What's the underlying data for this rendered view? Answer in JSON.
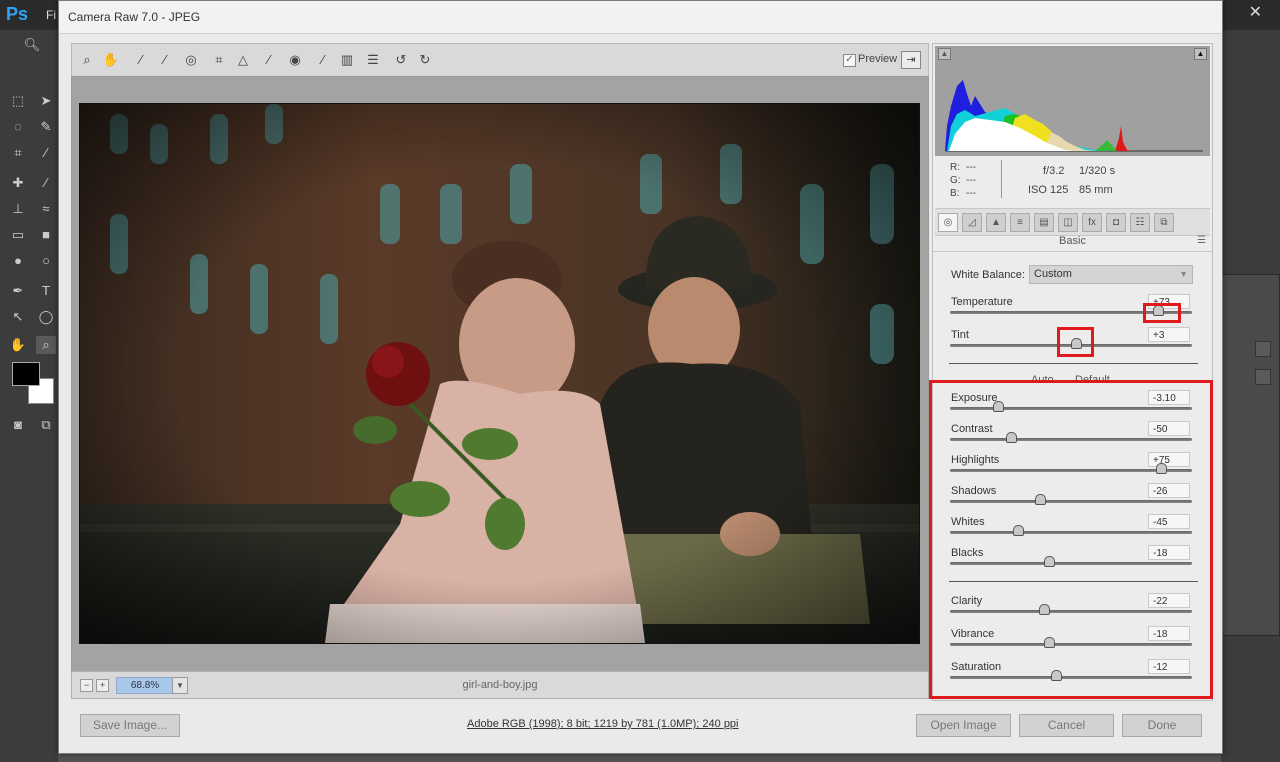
{
  "ps": {
    "logo": "Ps",
    "menu": "Fi",
    "close": "✕"
  },
  "dialog": {
    "title": "Camera Raw 7.0  -  JPEG",
    "preview_label": "Preview",
    "preview_checked": true,
    "zoom": "68.8%",
    "filename": "girl-and-boy.jpg",
    "save_button": "Save Image...",
    "info_link": "Adobe RGB (1998); 8 bit; 1219 by 781 (1.0MP); 240 ppi",
    "open_button": "Open Image",
    "cancel_button": "Cancel",
    "done_button": "Done"
  },
  "info": {
    "r_label": "R:",
    "r_value": "---",
    "g_label": "G:",
    "g_value": "---",
    "b_label": "B:",
    "b_value": "---",
    "aperture": "f/3.2",
    "shutter": "1/320 s",
    "iso": "ISO 125",
    "focal": "85 mm"
  },
  "panel": {
    "title": "Basic",
    "wb_label": "White Balance:",
    "wb_value": "Custom",
    "auto": "Auto",
    "default": "Default"
  },
  "sliders_wb": [
    {
      "label": "Temperature",
      "value": "+73",
      "pos": 0.86
    },
    {
      "label": "Tint",
      "value": "+3",
      "pos": 0.52
    }
  ],
  "sliders_tone": [
    {
      "label": "Exposure",
      "value": "-3.10",
      "pos": 0.2
    },
    {
      "label": "Contrast",
      "value": "-50",
      "pos": 0.25
    },
    {
      "label": "Highlights",
      "value": "+75",
      "pos": 0.87
    },
    {
      "label": "Shadows",
      "value": "-26",
      "pos": 0.37
    },
    {
      "label": "Whites",
      "value": "-45",
      "pos": 0.28
    },
    {
      "label": "Blacks",
      "value": "-18",
      "pos": 0.41
    }
  ],
  "sliders_presence": [
    {
      "label": "Clarity",
      "value": "-22",
      "pos": 0.39
    },
    {
      "label": "Vibrance",
      "value": "-18",
      "pos": 0.41
    },
    {
      "label": "Saturation",
      "value": "-12",
      "pos": 0.44
    }
  ],
  "colors": {
    "highlight_box": "#e0191c",
    "zoom_field": "#a8c8ea"
  }
}
